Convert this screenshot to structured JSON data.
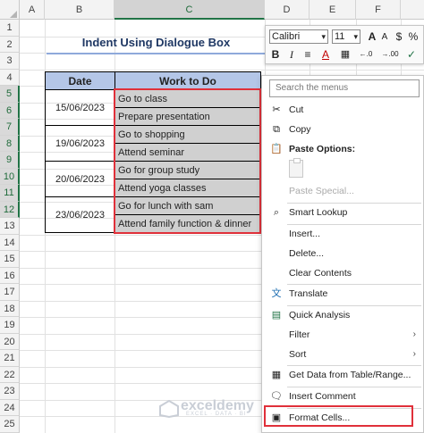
{
  "columns": [
    "A",
    "B",
    "C",
    "D",
    "E",
    "F"
  ],
  "rows": [
    "1",
    "2",
    "3",
    "4",
    "5",
    "6",
    "7",
    "8",
    "9",
    "10",
    "11",
    "12",
    "13",
    "14",
    "15",
    "16",
    "17",
    "18",
    "19",
    "20",
    "21",
    "22",
    "23",
    "24",
    "25"
  ],
  "sheet": {
    "title": "Indent Using Dialogue Box",
    "headers": {
      "date": "Date",
      "work": "Work to Do"
    },
    "dates": [
      "15/06/2023",
      "19/06/2023",
      "20/06/2023",
      "23/06/2023"
    ],
    "tasks": [
      "Go to class",
      "Prepare presentation",
      "Go to shopping",
      "Attend seminar",
      "Go for group study",
      "Attend yoga classes",
      "Go for lunch with sam",
      "Attend family function & dinner"
    ]
  },
  "mini_toolbar": {
    "font": "Calibri",
    "size": "11",
    "buttons": [
      "A",
      "A",
      "$",
      "%",
      "B",
      "I",
      "≡",
      "A",
      "▦",
      "←.0",
      "→.00",
      "✓"
    ]
  },
  "context_menu": {
    "search_placeholder": "Search the menus",
    "cut": "Cut",
    "copy": "Copy",
    "paste_options": "Paste Options:",
    "paste_special": "Paste Special...",
    "smart_lookup": "Smart Lookup",
    "insert": "Insert...",
    "delete": "Delete...",
    "clear_contents": "Clear Contents",
    "translate": "Translate",
    "quick_analysis": "Quick Analysis",
    "filter": "Filter",
    "sort": "Sort",
    "get_data": "Get Data from Table/Range...",
    "insert_comment": "Insert Comment",
    "format_cells": "Format Cells..."
  },
  "watermark": {
    "name": "exceldemy",
    "tagline": "EXCEL · DATA · BI"
  },
  "colors": {
    "accent": "#217346",
    "highlight": "#e0303a",
    "header_fill": "#b4c6e7"
  }
}
